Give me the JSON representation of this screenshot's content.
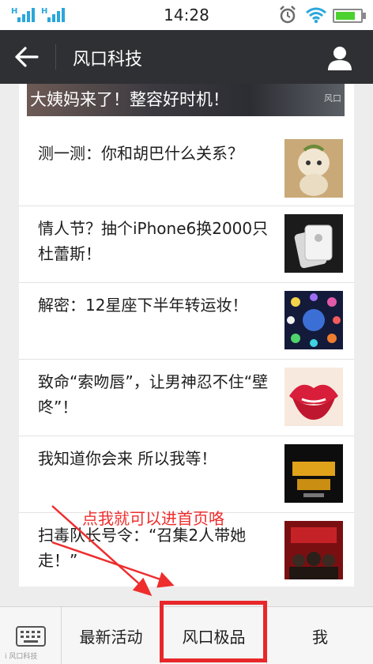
{
  "status_bar": {
    "time": "14:28",
    "signal_1_label": "H",
    "signal_2_label": "H",
    "battery_level": 0.7,
    "icons": [
      "signal-icon",
      "signal-icon",
      "alarm-icon",
      "wifi-icon",
      "battery-icon"
    ]
  },
  "header": {
    "title": "风口科技",
    "back_icon": "back-arrow-icon",
    "profile_icon": "person-icon",
    "background": "#2f3033"
  },
  "banner": {
    "text": "大姨妈来了！整容好时机！",
    "watermark": "风口"
  },
  "articles": [
    {
      "title": "测一测：你和胡巴什么关系？",
      "thumb": "huba-figure"
    },
    {
      "title": "情人节？抽个iPhone6换2000只杜蕾斯！",
      "thumb": "iphone"
    },
    {
      "title": "解密：12星座下半年转运妆！",
      "thumb": "zodiac"
    },
    {
      "title": "致命“索吻唇”，让男神忍不住“壁咚”！",
      "thumb": "lips"
    },
    {
      "title": "我知道你会来 所以我等！",
      "thumb": "poster-text"
    },
    {
      "title": "扫毒队长号令：“召集2人带她走！”",
      "thumb": "movie-poster"
    }
  ],
  "annotation": {
    "text": "点我就可以进首页咯",
    "color": "#ee2d2d"
  },
  "bottom_menu": {
    "keyboard_icon": "keyboard-icon",
    "items": [
      "最新活动",
      "风口极品",
      "我"
    ],
    "highlight_color": "#e8272a"
  },
  "watermark": "i 风口科技"
}
